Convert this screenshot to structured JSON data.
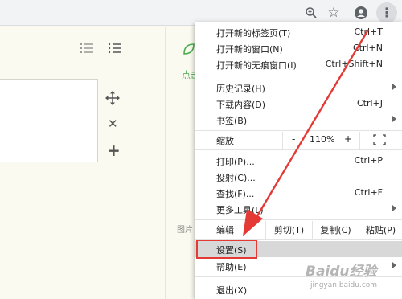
{
  "toolbar": {
    "zoom_icon": "zoom-icon",
    "star_icon": "star-icon",
    "profile_icon": "profile-icon",
    "menu_icon": "three-dots-vertical-icon"
  },
  "page": {
    "green_link_text": "点击",
    "side_label": "图片"
  },
  "menu": {
    "items": [
      {
        "label": "打开新的标签页(T)",
        "shortcut": "Ctrl+T"
      },
      {
        "label": "打开新的窗口(N)",
        "shortcut": "Ctrl+N"
      },
      {
        "label": "打开新的无痕窗口(I)",
        "shortcut": "Ctrl+Shift+N"
      },
      {
        "label": "历史记录(H)",
        "shortcut": ""
      },
      {
        "label": "下载内容(D)",
        "shortcut": "Ctrl+J"
      },
      {
        "label": "书签(B)",
        "shortcut": ""
      },
      {
        "label": "打印(P)...",
        "shortcut": "Ctrl+P"
      },
      {
        "label": "投射(C)...",
        "shortcut": ""
      },
      {
        "label": "查找(F)...",
        "shortcut": "Ctrl+F"
      },
      {
        "label": "更多工具(L)",
        "shortcut": ""
      },
      {
        "label": "设置(S)",
        "shortcut": ""
      },
      {
        "label": "帮助(E)",
        "shortcut": ""
      },
      {
        "label": "退出(X)",
        "shortcut": ""
      }
    ],
    "zoom": {
      "label": "缩放",
      "minus": "-",
      "value": "110%",
      "plus": "+"
    },
    "edit": {
      "label": "编辑",
      "cut": "剪切(T)",
      "copy": "复制(C)",
      "paste": "粘贴(P)"
    }
  },
  "watermark": {
    "logo": "Baidu经验",
    "url": "jingyan.baidu.com"
  },
  "colors": {
    "highlight_border": "#e53935",
    "arrow": "#e53935",
    "menu_hover": "#d8d8d8",
    "accent_green": "#4caf50"
  }
}
